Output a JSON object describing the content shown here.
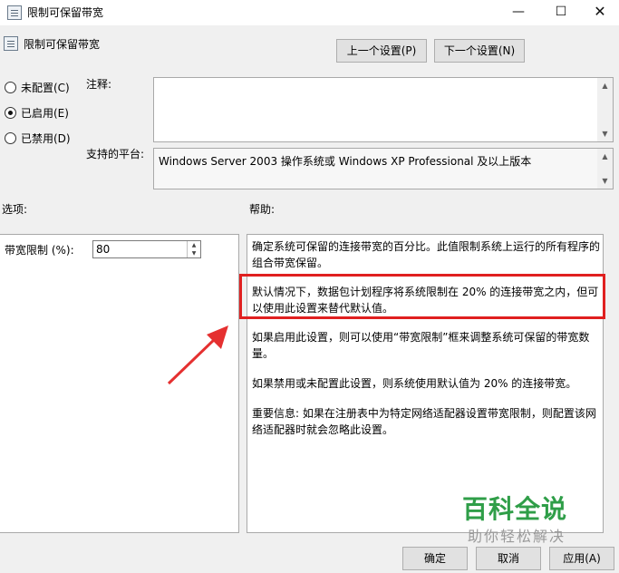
{
  "window": {
    "title": "限制可保留带宽",
    "minimize_glyph": "—",
    "maximize_glyph": "☐",
    "close_glyph": "✕"
  },
  "header": {
    "policy_name": "限制可保留带宽",
    "prev_button": "上一个设置(P)",
    "next_button": "下一个设置(N)"
  },
  "state_options": [
    {
      "label": "未配置(C)",
      "checked": false
    },
    {
      "label": "已启用(E)",
      "checked": true
    },
    {
      "label": "已禁用(D)",
      "checked": false
    }
  ],
  "comment": {
    "label": "注释:",
    "value": ""
  },
  "supported_on": {
    "label": "支持的平台:",
    "value": "Windows Server 2003 操作系统或 Windows XP Professional 及以上版本"
  },
  "options": {
    "heading": "选项:",
    "bandwidth_label": "带宽限制 (%):",
    "bandwidth_value": "80"
  },
  "help": {
    "heading": "帮助:",
    "paragraphs": [
      "确定系统可保留的连接带宽的百分比。此值限制系统上运行的所有程序的组合带宽保留。",
      "默认情况下，数据包计划程序将系统限制在 20% 的连接带宽之内，但可以使用此设置来替代默认值。",
      "如果启用此设置，则可以使用“带宽限制”框来调整系统可保留的带宽数量。",
      "如果禁用或未配置此设置，则系统使用默认值为 20% 的连接带宽。",
      "重要信息: 如果在注册表中为特定网络适配器设置带宽限制，则配置该网络适配器时就会忽略此设置。"
    ]
  },
  "watermark": {
    "line1": "百科全说",
    "line2": "助你轻松解决"
  },
  "footer": {
    "ok": "确定",
    "cancel": "取消",
    "apply": "应用(A)"
  },
  "colors": {
    "highlight": "#e02020",
    "arrow": "#e53030",
    "watermark_green": "#2f9e48"
  }
}
